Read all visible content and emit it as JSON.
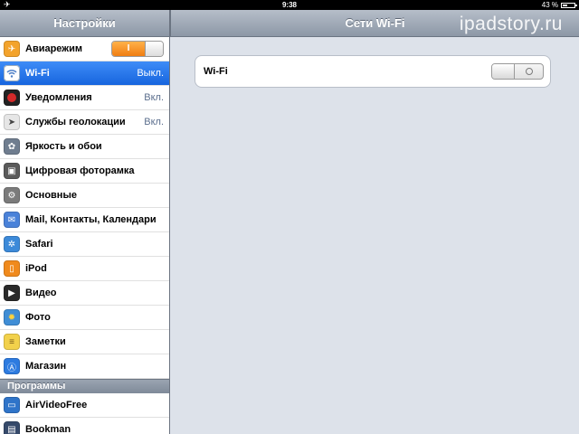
{
  "statusbar": {
    "time": "9:38",
    "battery": "43 %",
    "battery_level": 0.43
  },
  "sidebar": {
    "title": "Настройки",
    "items": [
      {
        "label": "Авиарежим",
        "value": "",
        "icon": "airplane-icon",
        "color": "#f3a32c",
        "toggle_label": "I"
      },
      {
        "label": "Wi-Fi",
        "value": "Выкл.",
        "icon": "wifi-icon",
        "color": "#4d7fc7",
        "selected": true
      },
      {
        "label": "Уведомления",
        "value": "Вкл.",
        "icon": "notifications-icon",
        "color": "#d42a2a"
      },
      {
        "label": "Службы геолокации",
        "value": "Вкл.",
        "icon": "location-icon",
        "color": "#8a8a8a"
      },
      {
        "label": "Яркость и обои",
        "value": "",
        "icon": "brightness-icon",
        "color": "#6f7d8f"
      },
      {
        "label": "Цифровая фоторамка",
        "value": "",
        "icon": "photo-frame-icon",
        "color": "#5a5a5a"
      },
      {
        "label": "Основные",
        "value": "",
        "icon": "gear-icon",
        "color": "#7b7b7b"
      },
      {
        "label": "Mail, Контакты, Календари",
        "value": "",
        "icon": "mail-icon",
        "color": "#4a82d9"
      },
      {
        "label": "Safari",
        "value": "",
        "icon": "safari-icon",
        "color": "#3c8ad9"
      },
      {
        "label": "iPod",
        "value": "",
        "icon": "ipod-icon",
        "color": "#f08a1d"
      },
      {
        "label": "Видео",
        "value": "",
        "icon": "video-icon",
        "color": "#2a2a2a"
      },
      {
        "label": "Фото",
        "value": "",
        "icon": "photos-icon",
        "color": "#3f8ed6"
      },
      {
        "label": "Заметки",
        "value": "",
        "icon": "notes-icon",
        "color": "#f2d14b"
      },
      {
        "label": "Магазин",
        "value": "",
        "icon": "store-icon",
        "color": "#2d7be0"
      }
    ],
    "section": "Программы",
    "apps": [
      {
        "label": "AirVideoFree",
        "icon": "airvideo-icon",
        "color": "#2f74c9"
      },
      {
        "label": "Bookman",
        "icon": "bookman-icon",
        "color": "#364a6b"
      }
    ]
  },
  "detail": {
    "title": "Сети Wi-Fi",
    "watermark": "ipadstory.ru",
    "wifi_label": "Wi-Fi",
    "wifi_state": "0"
  }
}
